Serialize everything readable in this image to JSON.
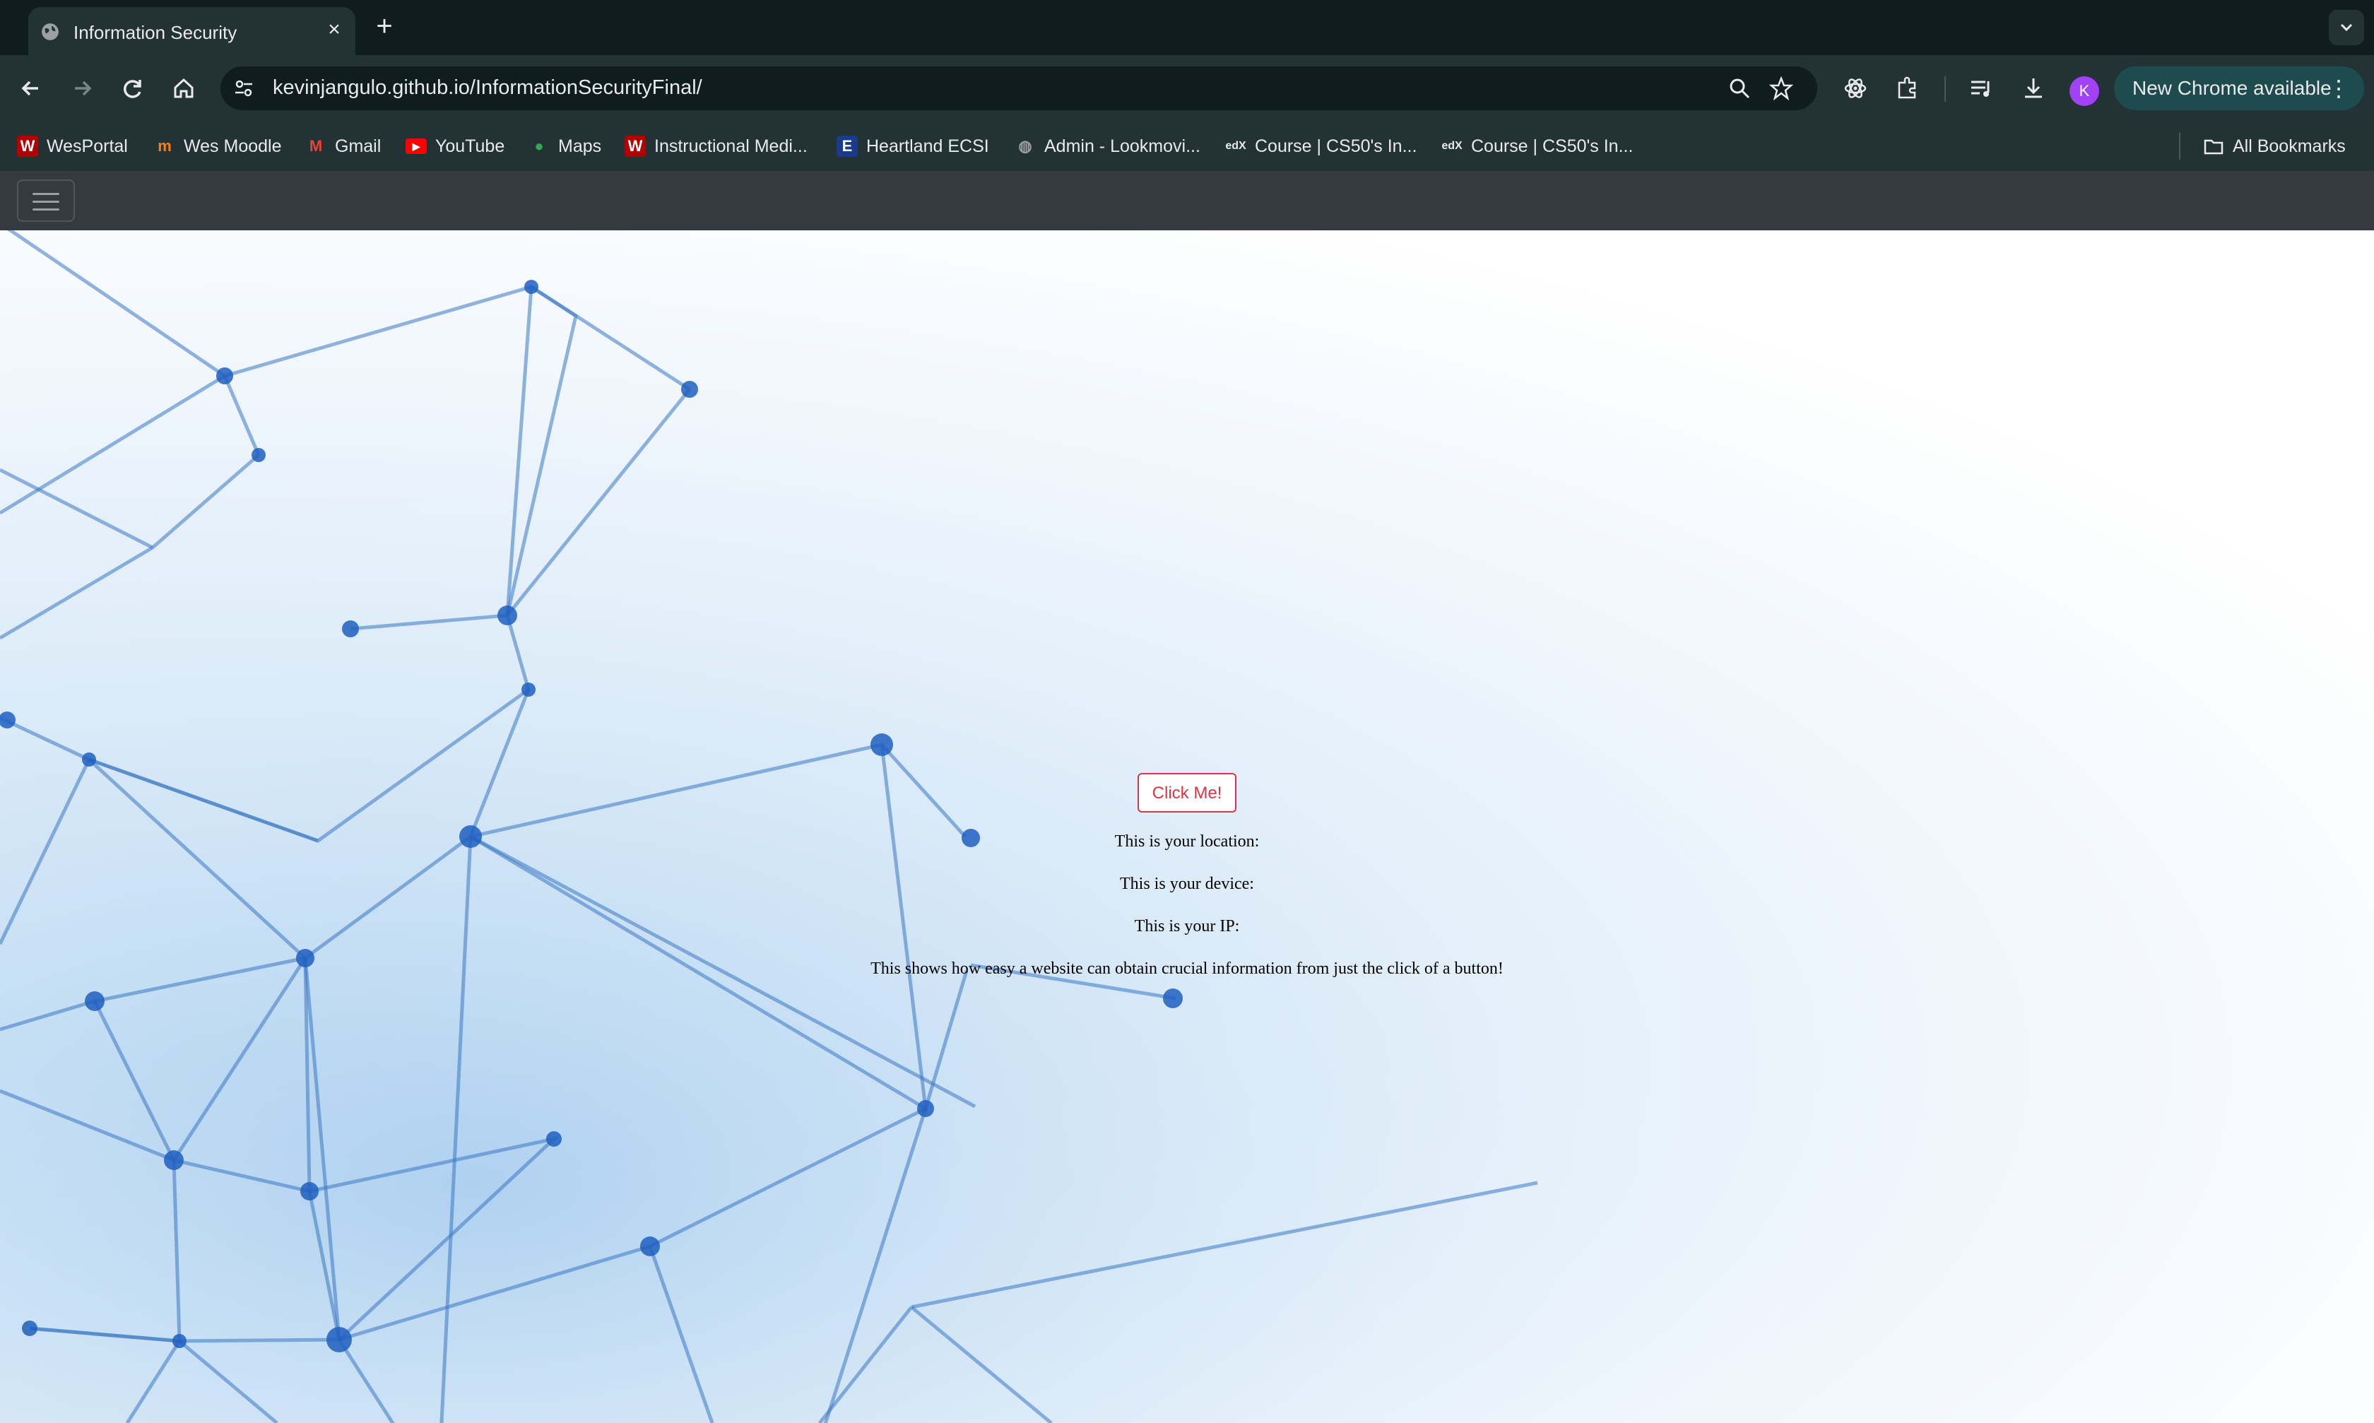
{
  "browser": {
    "tab_title": "Information Security",
    "url": "kevinjangulo.github.io/InformationSecurityFinal/",
    "update_chip": "New Chrome available",
    "profile_initial": "K"
  },
  "bookmarks": [
    {
      "label": "WesPortal",
      "icon": "wesportal-icon"
    },
    {
      "label": "Wes Moodle",
      "icon": "moodle-icon"
    },
    {
      "label": "Gmail",
      "icon": "gmail-icon"
    },
    {
      "label": "YouTube",
      "icon": "youtube-icon"
    },
    {
      "label": "Maps",
      "icon": "maps-icon"
    },
    {
      "label": "Instructional Medi...",
      "icon": "wes-icon"
    },
    {
      "label": "Heartland ECSI",
      "icon": "ecsi-icon"
    },
    {
      "label": "Admin - Lookmovi...",
      "icon": "globe-icon"
    },
    {
      "label": "Course | CS50's In...",
      "icon": "edx-icon"
    },
    {
      "label": "Course | CS50's In...",
      "icon": "edx-icon"
    }
  ],
  "all_bookmarks": "All Bookmarks",
  "page": {
    "button_label": "Click Me!",
    "location_text": "This is your location:",
    "device_text": "This is your device:",
    "ip_text": "This is your IP:",
    "message": "This shows how easy a website can obtain crucial information from just the click of a button!"
  },
  "colors": {
    "button_accent": "#dc3545",
    "navbar_bg": "#343a40",
    "chrome_toolbar": "#233234"
  }
}
